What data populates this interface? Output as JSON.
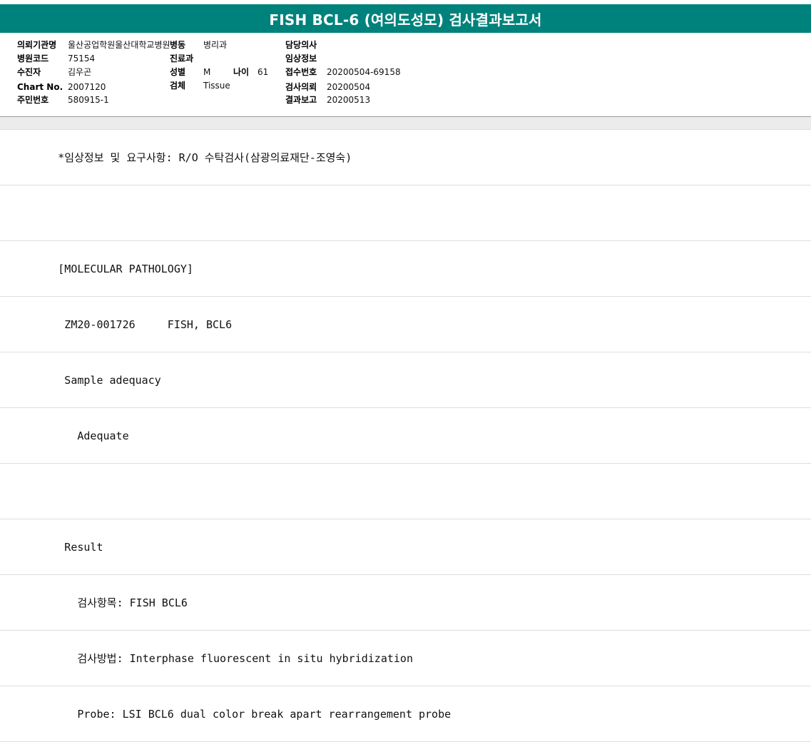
{
  "report": {
    "title": "FISH BCL-6 (여의도성모) 검사결과보고서"
  },
  "header": {
    "institution_label": "의뢰기관명",
    "institution_value": "울산공업학원울산대학교병원",
    "ward_label": "병동",
    "ward_value": "병리과",
    "doctor_label": "담당의사",
    "doctor_value": "",
    "hospital_code_label": "병원코드",
    "hospital_code_value": "75154",
    "department_label": "진료과",
    "department_value": "",
    "clinical_info_label": "임상정보",
    "clinical_info_value": "",
    "patient_label": "수진자",
    "patient_value": "김우곤",
    "sex_label": "성별",
    "sex_value": "M",
    "age_label": "나이",
    "age_value": "61",
    "receipt_no_label": "접수번호",
    "receipt_no_value": "20200504-69158",
    "chart_no_label": "Chart No.",
    "chart_no_value": "2007120",
    "specimen_label": "검체",
    "specimen_value": "Tissue",
    "request_date_label": "검사의뢰",
    "request_date_value": "20200504",
    "resident_no_label": "주민번호",
    "resident_no_value": "580915-1",
    "report_date_label": "결과보고",
    "report_date_value": "20200513"
  },
  "body_lines": [
    "         *임상정보 및 요구사항: R/O 수탁검사(삼광의료재단-조영숙)",
    "",
    "         [MOLECULAR PATHOLOGY]",
    "          ZM20-001726     FISH, BCL6",
    "          Sample adequacy",
    "            Adequate",
    "",
    "          Result",
    "            검사항목: FISH BCL6",
    "            검사방법: Interphase fluorescent in situ hybridization",
    "            Probe: LSI BCL6 dual color break apart rearrangement probe"
  ]
}
